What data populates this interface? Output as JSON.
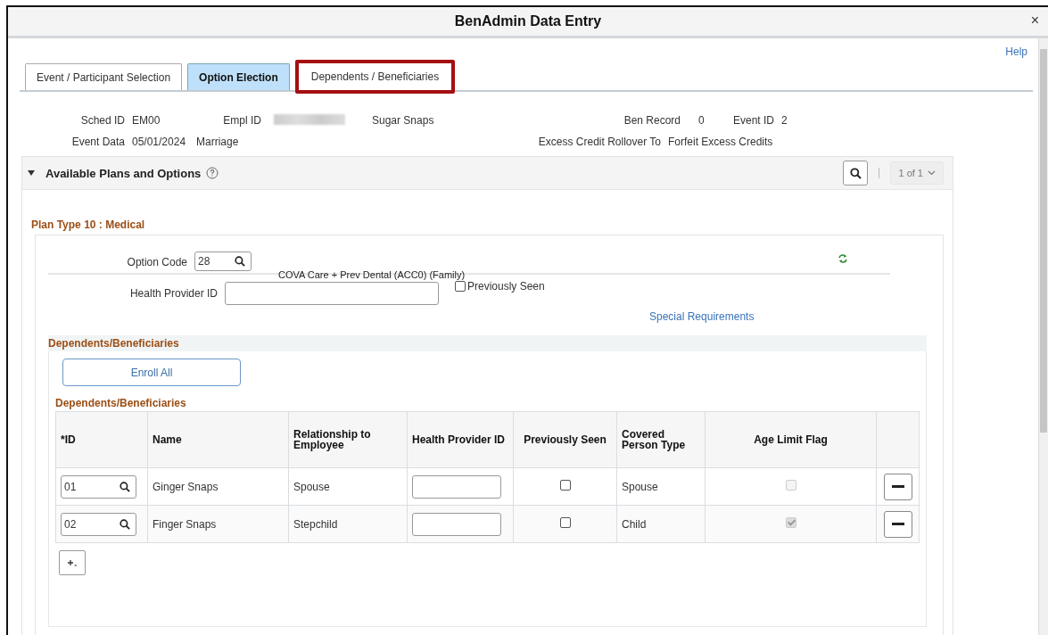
{
  "window": {
    "title": "BenAdmin Data Entry",
    "close": "×"
  },
  "help_link": "Help",
  "tabs": [
    {
      "label": "Event / Participant Selection",
      "selected": false,
      "highlighted": false
    },
    {
      "label": "Option Election",
      "selected": true,
      "highlighted": false
    },
    {
      "label": "Dependents / Beneficiaries",
      "selected": false,
      "highlighted": true
    }
  ],
  "header": {
    "sched_id_label": "Sched ID",
    "sched_id": "EM00",
    "empl_id_label": "Empl ID",
    "empl_id_redacted": true,
    "employee_name": "Sugar Snaps",
    "ben_record_label": "Ben Record",
    "ben_record": "0",
    "event_id_label": "Event ID",
    "event_id": "2",
    "event_data_label": "Event Data",
    "event_date": "05/01/2024",
    "event_reason": "Marriage",
    "rollover_label": "Excess Credit Rollover To",
    "rollover": "Forfeit Excess Credits"
  },
  "panel": {
    "title": "Available Plans and Options",
    "expanded": true,
    "pager": "1 of 1",
    "plan_title": "Plan Type 10 : Medical",
    "option_code_label": "Option Code",
    "option_code": "28",
    "option_description": "COVA Care + Prev Dental (ACC0) (Family)",
    "health_provider_label": "Health Provider ID",
    "previously_seen": {
      "label": "Previously Seen",
      "checked": false
    },
    "special_requirements": "Special Requirements",
    "dependents_section_title": "Dependents/Beneficiaries",
    "enroll_all": "Enroll All",
    "grid_title": "Dependents/Beneficiaries",
    "columns": [
      "*ID",
      "Name",
      "Relationship to Employee",
      "Health Provider ID",
      "Previously Seen",
      "Covered Person Type",
      "Age Limit Flag"
    ],
    "rows": [
      {
        "id": "01",
        "name": "Ginger Snaps",
        "relationship": "Spouse",
        "previously_seen": false,
        "covered_type": "Spouse",
        "age_limit_flag": false
      },
      {
        "id": "02",
        "name": "Finger Snaps",
        "relationship": "Stepchild",
        "previously_seen": false,
        "covered_type": "Child",
        "age_limit_flag": true
      }
    ]
  }
}
